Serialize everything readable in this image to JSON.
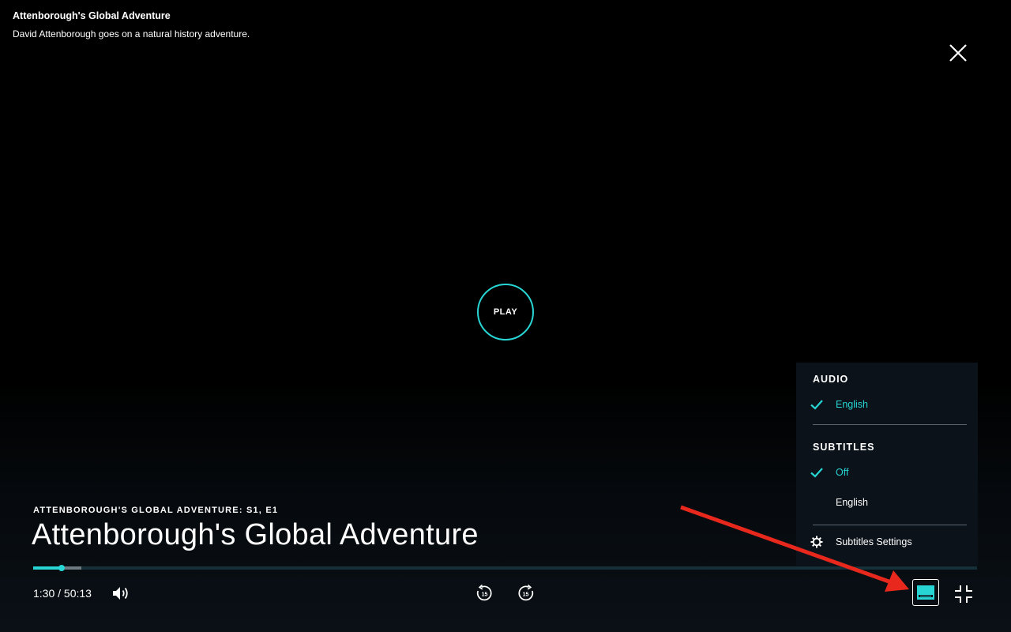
{
  "header": {
    "title": "Attenborough's Global Adventure",
    "description": "David Attenborough goes on a natural history adventure."
  },
  "play_button": {
    "label": "PLAY"
  },
  "episode": {
    "label": "ATTENBOROUGH'S GLOBAL ADVENTURE: S1, E1",
    "title": "Attenborough's Global Adventure"
  },
  "playback": {
    "time": "1:30 / 50:13",
    "played_fraction": 0.03,
    "buffered_fraction": 0.051
  },
  "menu": {
    "audio_heading": "AUDIO",
    "audio_options": [
      {
        "label": "English",
        "selected": true
      }
    ],
    "subtitles_heading": "SUBTITLES",
    "subtitle_options": [
      {
        "label": "Off",
        "selected": true
      },
      {
        "label": "English",
        "selected": false
      }
    ],
    "settings_label": "Subtitles Settings"
  },
  "icons": {
    "close": "close-icon",
    "volume": "volume-icon",
    "rewind": "rewind-15-icon",
    "forward": "forward-15-icon",
    "subtitles": "subtitles-icon",
    "exit_fullscreen": "exit-fullscreen-icon",
    "check": "check-icon",
    "gear": "gear-icon"
  },
  "colors": {
    "accent": "#27d6d4",
    "annotation_arrow": "#e8281c",
    "menu_background": "#0b1219"
  }
}
